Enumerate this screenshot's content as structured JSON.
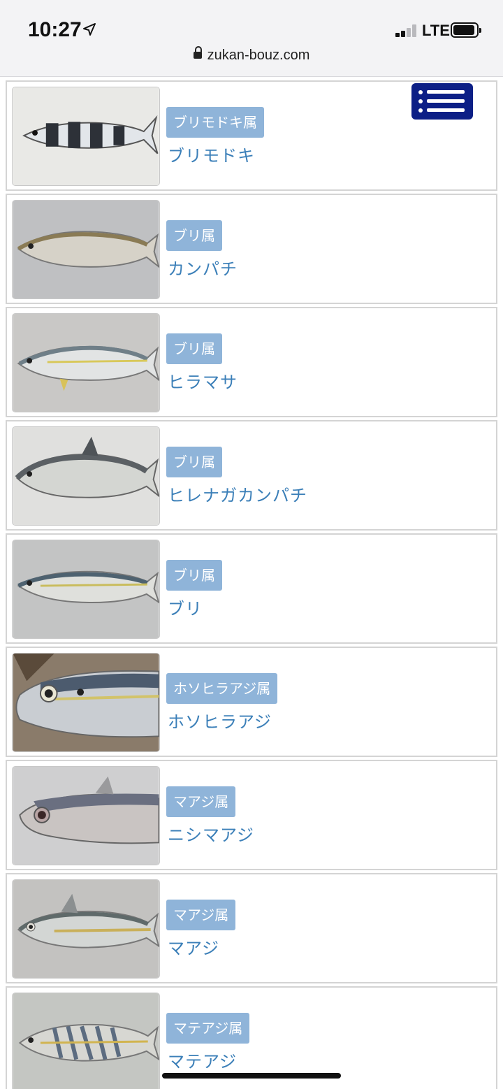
{
  "status": {
    "time": "10:27",
    "network": "LTE"
  },
  "browser": {
    "url": "zukan-bouz.com"
  },
  "menu": {
    "icon": "hamburger-menu-icon",
    "color": "#0c1f86"
  },
  "colors": {
    "genus_badge": "#8fb4d9",
    "species_link": "#3b7fb8"
  },
  "fish_list": [
    {
      "genus": "ブリモドキ属",
      "name": "ブリモドキ",
      "thumb": "pilot-fish-photo"
    },
    {
      "genus": "ブリ属",
      "name": "カンパチ",
      "thumb": "amberjack-photo"
    },
    {
      "genus": "ブリ属",
      "name": "ヒラマサ",
      "thumb": "yellowtail-kingfish-photo"
    },
    {
      "genus": "ブリ属",
      "name": "ヒレナガカンパチ",
      "thumb": "almaco-jack-photo"
    },
    {
      "genus": "ブリ属",
      "name": "ブリ",
      "thumb": "yellowtail-photo"
    },
    {
      "genus": "ホソヒラアジ属",
      "name": "ホソヒラアジ",
      "thumb": "scad-photo"
    },
    {
      "genus": "マアジ属",
      "name": "ニシマアジ",
      "thumb": "horse-mackerel-photo"
    },
    {
      "genus": "マアジ属",
      "name": "マアジ",
      "thumb": "japanese-jack-mackerel-photo"
    },
    {
      "genus": "マテアジ属",
      "name": "マテアジ",
      "thumb": "blue-mackerel-scad-photo"
    }
  ]
}
